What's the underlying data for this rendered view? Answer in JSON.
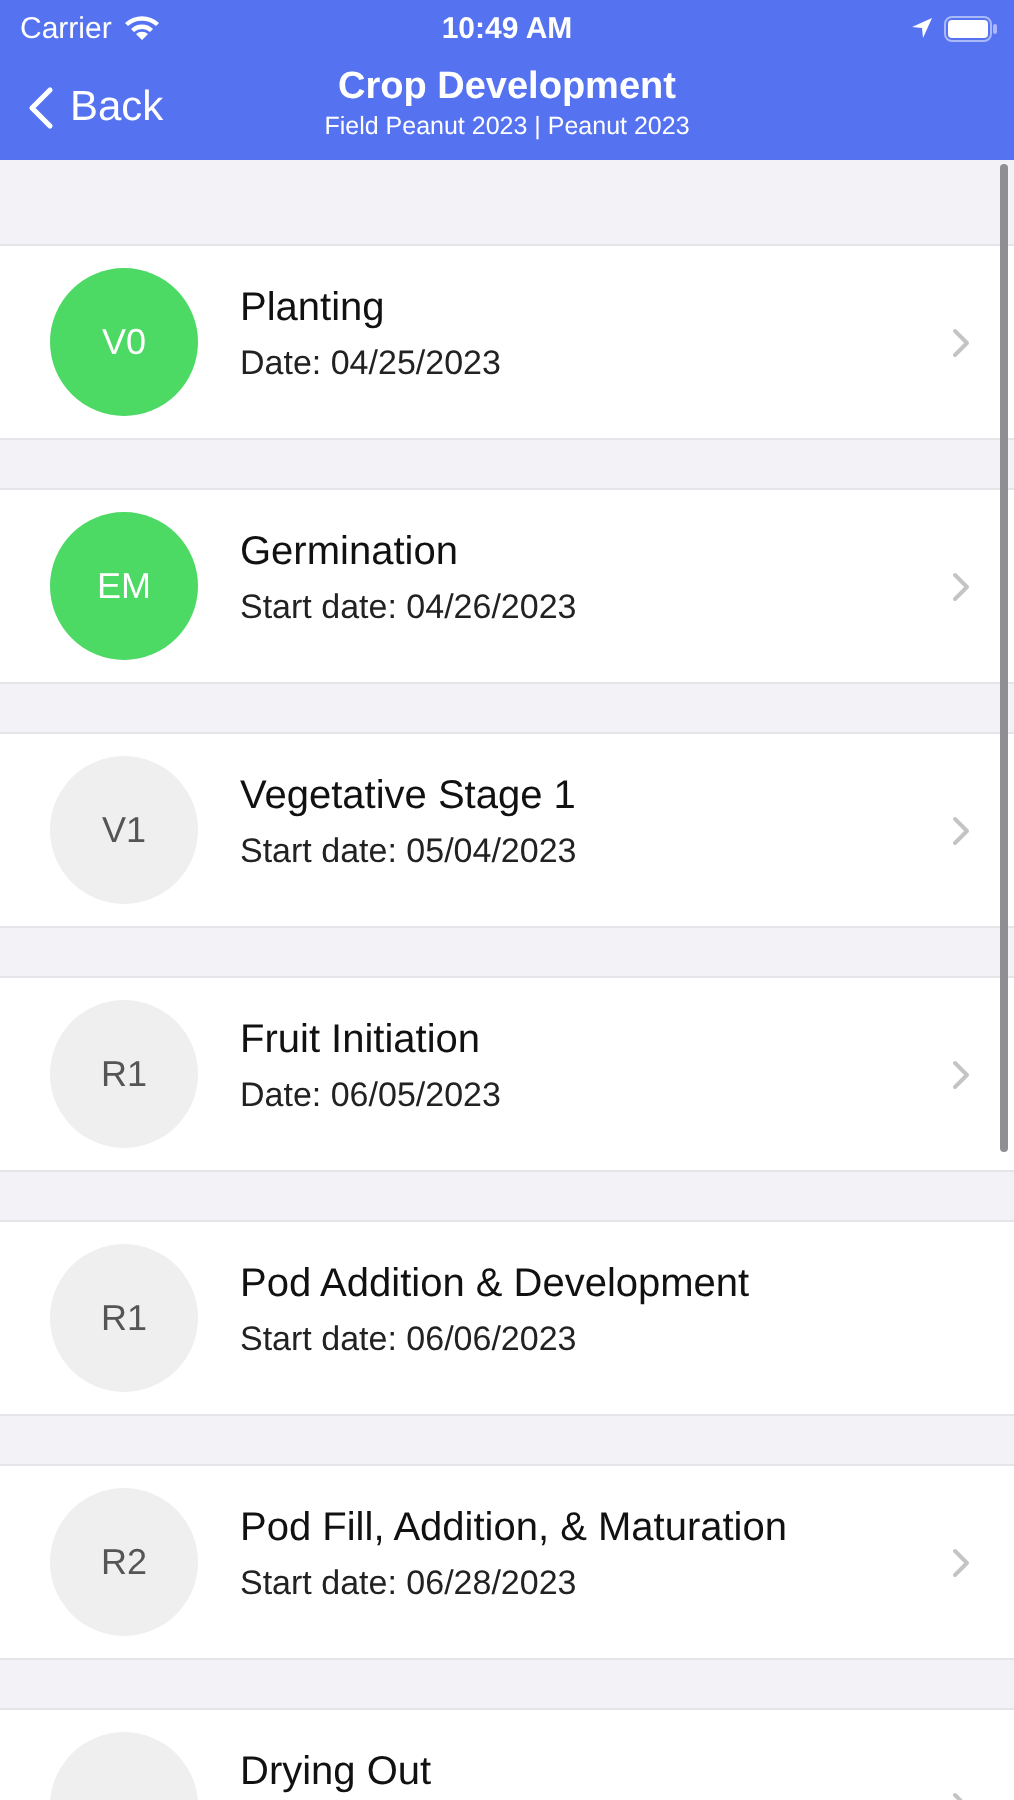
{
  "status_bar": {
    "carrier": "Carrier",
    "time": "10:49 AM"
  },
  "nav": {
    "back": "Back",
    "title": "Crop Development",
    "subtitle": "Field Peanut 2023 | Peanut 2023"
  },
  "stages": [
    {
      "code": "V0",
      "title": "Planting",
      "date": "Date: 04/25/2023",
      "done": true,
      "chevron": true
    },
    {
      "code": "EM",
      "title": "Germination",
      "date": "Start date: 04/26/2023",
      "done": true,
      "chevron": true
    },
    {
      "code": "V1",
      "title": "Vegetative Stage 1",
      "date": "Start date: 05/04/2023",
      "done": false,
      "chevron": true
    },
    {
      "code": "R1",
      "title": "Fruit Initiation",
      "date": "Date: 06/05/2023",
      "done": false,
      "chevron": true
    },
    {
      "code": "R1",
      "title": "Pod Addition & Development",
      "date": "Start date: 06/06/2023",
      "done": false,
      "chevron": false
    },
    {
      "code": "R2",
      "title": "Pod Fill, Addition, & Maturation",
      "date": "Start date: 06/28/2023",
      "done": false,
      "chevron": true
    },
    {
      "title": "Drying Out",
      "done": false,
      "chevron": true
    }
  ]
}
